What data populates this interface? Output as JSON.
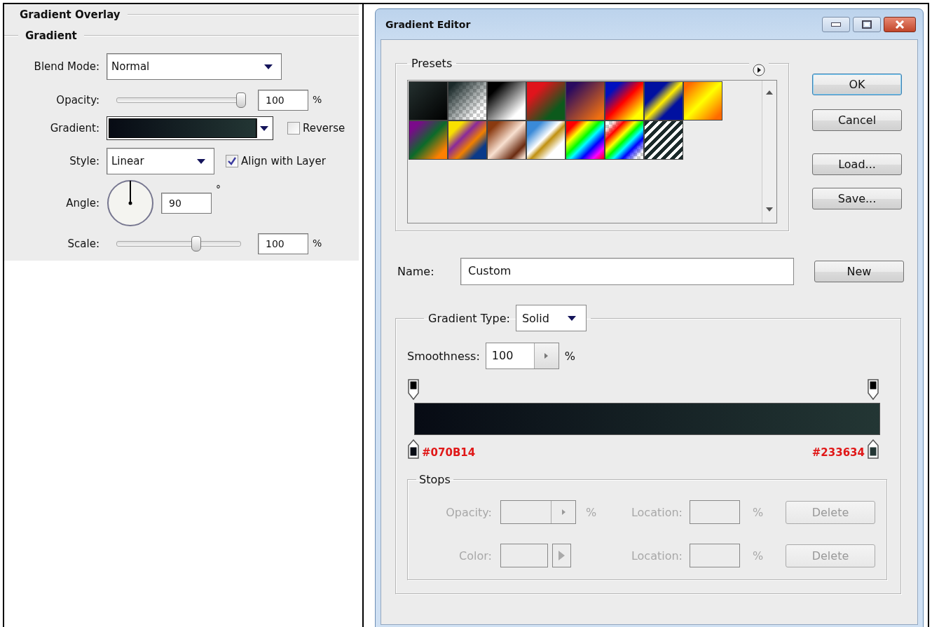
{
  "layer_style": {
    "title": "Gradient Overlay",
    "section": "Gradient",
    "blend_mode": {
      "label": "Blend Mode:",
      "value": "Normal"
    },
    "opacity": {
      "label": "Opacity:",
      "level": 1,
      "value": "100",
      "unit": "%"
    },
    "gradient": {
      "label": "Gradient:"
    },
    "reverse": {
      "label": "Reverse",
      "checked": false
    },
    "style": {
      "label": "Style:",
      "value": "Linear"
    },
    "align_with_layer": {
      "label": "Align with Layer",
      "checked": true
    },
    "angle": {
      "label": "Angle:",
      "value": "90",
      "unit": "°"
    },
    "scale": {
      "label": "Scale:",
      "level": 0.64,
      "value": "100",
      "unit": "%"
    }
  },
  "gradient_editor": {
    "title": "Gradient Editor",
    "presets": {
      "label": "Presets"
    },
    "buttons": [
      {
        "label": "OK",
        "default": true
      },
      {
        "label": "Cancel",
        "default": false
      },
      {
        "label": "Load...",
        "default": false
      },
      {
        "label": "Save...",
        "default": false
      }
    ],
    "name": {
      "label": "Name:",
      "value": "Custom"
    },
    "new_button": "New",
    "gradient_type": {
      "label": "Gradient Type:",
      "value": "Solid"
    },
    "smoothness": {
      "label": "Smoothness:",
      "value": "100",
      "unit": "%"
    },
    "color_stops": [
      {
        "label": "#070B14",
        "color": "#070b14"
      },
      {
        "label": "#233634",
        "color": "#233634"
      }
    ],
    "stops": {
      "label": "Stops",
      "rows": [
        {
          "kind": "opacity",
          "label": "Opacity:",
          "unit": "%",
          "location_label": "Location:",
          "location_unit": "%",
          "button": "Delete",
          "disabled": true
        },
        {
          "kind": "color",
          "label": "Color:",
          "location_label": "Location:",
          "location_unit": "%",
          "button": "Delete",
          "disabled": true
        }
      ]
    }
  }
}
